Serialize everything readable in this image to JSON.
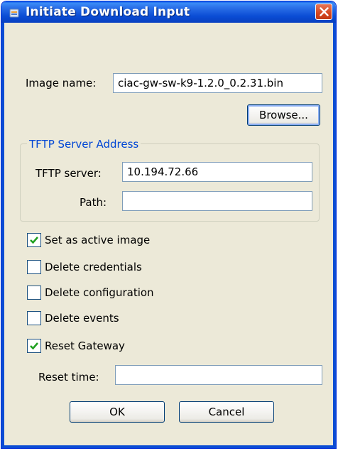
{
  "window": {
    "title": "Initiate Download Input"
  },
  "image_name": {
    "label": "Image name:",
    "value": "ciac-gw-sw-k9-1.2.0_0.2.31.bin"
  },
  "browse_button": {
    "label": "Browse..."
  },
  "tftp_group": {
    "title": "TFTP Server Address",
    "server_label": "TFTP server:",
    "server_value": "10.194.72.66",
    "path_label": "Path:",
    "path_value": ""
  },
  "options": [
    {
      "label": "Set as active image",
      "checked": true
    },
    {
      "label": "Delete credentials",
      "checked": false
    },
    {
      "label": "Delete configuration",
      "checked": false
    },
    {
      "label": "Delete events",
      "checked": false
    },
    {
      "label": "Reset Gateway",
      "checked": true
    }
  ],
  "reset_time": {
    "label": "Reset time:",
    "value": ""
  },
  "buttons": {
    "ok": "OK",
    "cancel": "Cancel"
  },
  "colors": {
    "titlebar": "#0a4cd4",
    "background": "#ece9d8",
    "group_title": "#0046d5",
    "check": "#21a121"
  }
}
